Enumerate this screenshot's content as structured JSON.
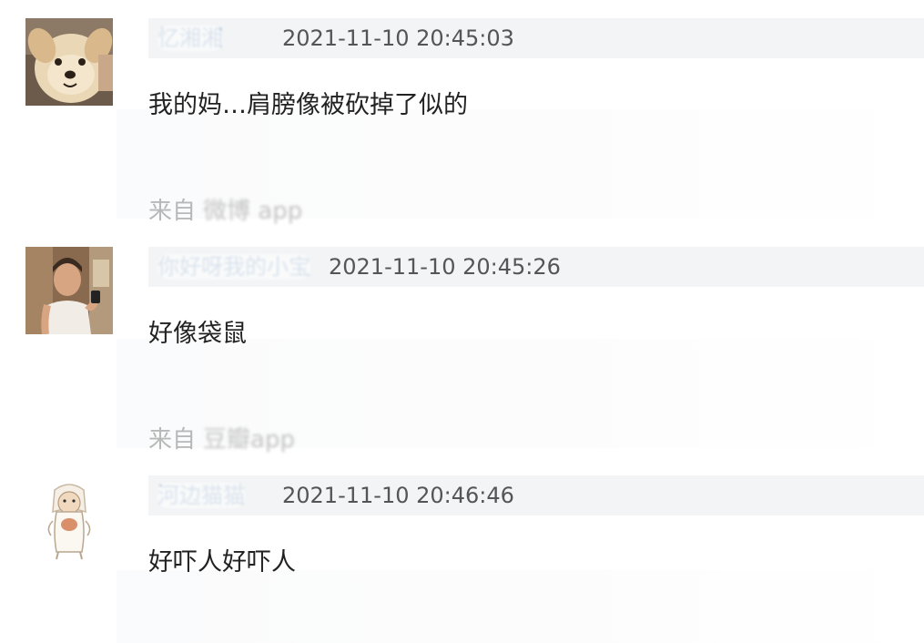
{
  "comments": [
    {
      "avatar_icon": "puppy-avatar-icon",
      "username": "忆湘湘",
      "timestamp": "2021-11-10 20:45:03",
      "text": "我的妈…肩膀像被砍掉了似的",
      "source_prefix": "来自",
      "source_app": "微博 app"
    },
    {
      "avatar_icon": "selfie-avatar-icon",
      "username": "你好呀我的小宝",
      "timestamp": "2021-11-10 20:45:26",
      "text": "好像袋鼠",
      "source_prefix": "来自",
      "source_app": "豆瓣app"
    },
    {
      "avatar_icon": "cartoon-figure-avatar-icon",
      "username": "河边猫猫",
      "timestamp": "2021-11-10 20:46:46",
      "text": "好吓人好吓人"
    }
  ],
  "colors": {
    "header_bg": "#f2f4f5",
    "username": "#4a78b0",
    "timestamp": "#555555",
    "content": "#222222",
    "source": "#b8b8b8"
  }
}
